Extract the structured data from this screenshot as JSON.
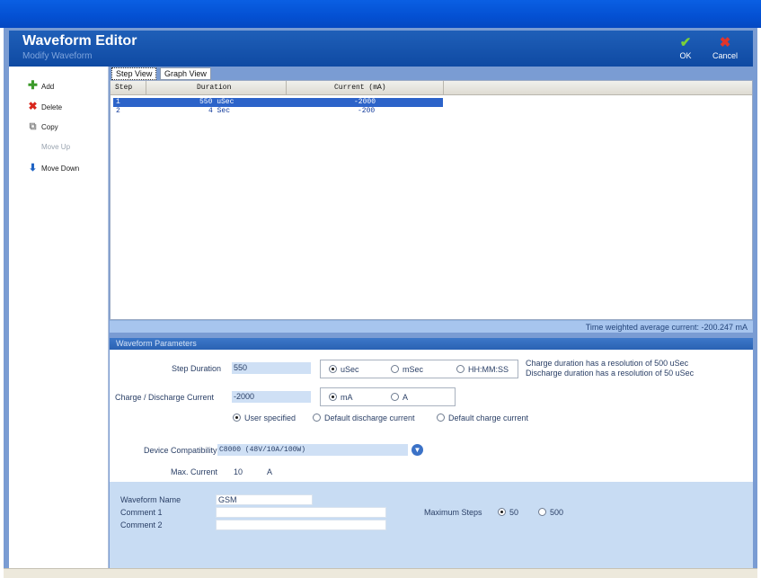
{
  "header": {
    "title": "Waveform Editor",
    "subtitle": "Modify Waveform",
    "ok_label": "OK",
    "cancel_label": "Cancel"
  },
  "sidebar": {
    "items": [
      {
        "label": "Add",
        "icon": "add-icon",
        "enabled": true
      },
      {
        "label": "Delete",
        "icon": "delete-icon",
        "enabled": true
      },
      {
        "label": "Copy",
        "icon": "copy-icon",
        "enabled": true
      },
      {
        "label": "Move Up",
        "icon": "move-up-icon",
        "enabled": false
      },
      {
        "label": "Move Down",
        "icon": "move-down-icon",
        "enabled": true
      }
    ]
  },
  "tabs": [
    {
      "label": "Step View",
      "active": true
    },
    {
      "label": "Graph View",
      "active": false
    }
  ],
  "table": {
    "columns": [
      "Step",
      "Duration",
      "Current (mA)"
    ],
    "rows": [
      {
        "step": "1",
        "duration": "550 uSec",
        "current": "-2000",
        "selected": true
      },
      {
        "step": "2",
        "duration": "4 Sec",
        "current": "-200",
        "selected": false
      }
    ]
  },
  "summary": {
    "average_current": "Time weighted average current: -200.247 mA"
  },
  "params": {
    "title": "Waveform Parameters",
    "step_duration_label": "Step Duration",
    "step_duration_value": "550",
    "duration_units": [
      "uSec",
      "mSec",
      "HH:MM:SS"
    ],
    "duration_unit_selected": "uSec",
    "charge_note": "Charge duration has a resolution of 500 uSec",
    "discharge_note": "Discharge duration has a resolution of 50 uSec",
    "current_label": "Charge / Discharge Current",
    "current_value": "-2000",
    "current_units": [
      "mA",
      "A"
    ],
    "current_unit_selected": "mA",
    "current_modes": [
      "User specified",
      "Default discharge current",
      "Default charge current"
    ],
    "current_mode_selected": "User specified",
    "device_label": "Device Compatibility",
    "device_value": "C8000 (48V/10A/100W)",
    "max_current_label": "Max. Current",
    "max_current_value": "10",
    "max_current_unit": "A"
  },
  "info": {
    "name_label": "Waveform Name",
    "name_value": "GSM",
    "comment1_label": "Comment 1",
    "comment1_value": "",
    "comment2_label": "Comment 2",
    "comment2_value": "",
    "max_steps_label": "Maximum Steps",
    "max_steps_options": [
      "50",
      "500"
    ],
    "max_steps_selected": "50"
  },
  "colors": {
    "title_bar": "#0450d2",
    "header": "#1a56af",
    "selection": "#2c63c9",
    "panel": "#c8dcf3",
    "accent_green": "#7ad03a",
    "accent_red": "#e0352b"
  }
}
